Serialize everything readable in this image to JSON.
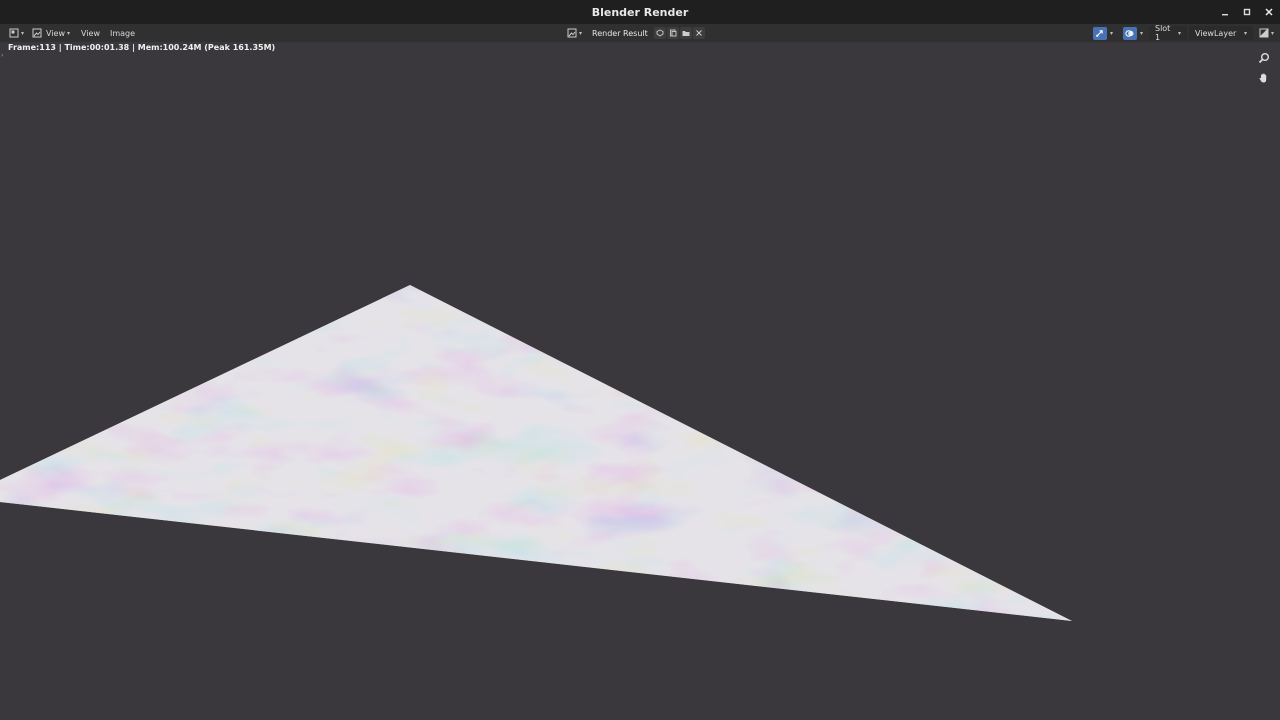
{
  "window": {
    "title": "Blender Render",
    "controls": [
      "minimize-icon",
      "maximize-icon",
      "close-icon"
    ]
  },
  "header": {
    "editor_type_icon": "image-editor-icon",
    "view_mode_label": "View",
    "menus": [
      "View",
      "Image"
    ],
    "image_browse_icon": "image-browse-icon",
    "image_name": "Render Result",
    "image_buttons": [
      "fake-user-icon",
      "new-image-icon",
      "open-folder-icon",
      "unlink-close-icon"
    ],
    "gizmo_toggle_icon": "gizmo-icon",
    "overlay_toggle_icon": "overlay-icon",
    "slot_label": "Slot 1",
    "view_layer_label": "ViewLayer",
    "display_channels_icon": "display-channels-icon"
  },
  "stats": {
    "text": "Frame:113 | Time:00:01.38 | Mem:100.24M (Peak 161.35M)"
  },
  "viewport_tools": [
    "zoom-icon",
    "pan-hand-icon"
  ],
  "colors": {
    "background": "#3a383c",
    "titlebar": "#1f1f1f",
    "header": "#303030",
    "accent": "#4772b3"
  }
}
